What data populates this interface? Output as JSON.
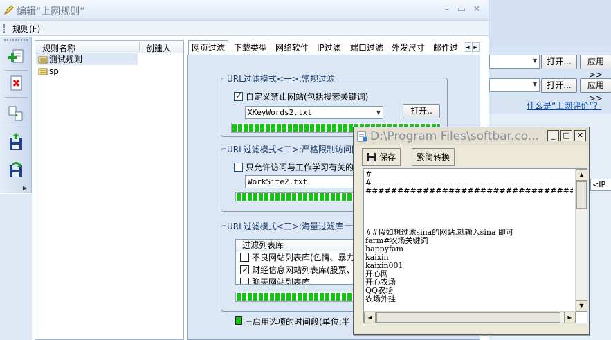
{
  "main_window": {
    "title": "编辑“上网规则”",
    "minimize": "–",
    "maximize": "▭",
    "close": "✕"
  },
  "menu": {
    "rules": "规则(F)"
  },
  "rule_list": {
    "columns": [
      "规则名称",
      "创建人"
    ],
    "rows": [
      {
        "name": "测试规则"
      },
      {
        "name": "sp"
      }
    ]
  },
  "tabs": [
    "网页过滤",
    "下载类型",
    "网络软件",
    "IP过滤",
    "端口过滤",
    "外发尺寸",
    "邮件过"
  ],
  "tab_arrows": {
    "left": "◄",
    "right": "►"
  },
  "mode1": {
    "title": "URL过滤模式<一>:常规过滤",
    "checkbox_label": "自定义禁止网站(包括搜索关键词)",
    "file": "XKeyWords2.txt",
    "open_button": "打开.."
  },
  "mode2": {
    "title": "URL过滤模式<二>:严格限制访问网站",
    "checkbox_label": "只允许访问与工作学习有关的",
    "file": "WorkSite2.txt"
  },
  "mode3": {
    "title": "URL过滤模式<三>:海量过滤库",
    "list_header": "过滤列表库",
    "items": [
      {
        "label": "不良网站列表库(色情、暴力)",
        "checked": false
      },
      {
        "label": "财经信息网站列表库(股票、",
        "checked": true
      },
      {
        "label": "聊天网站列表库、",
        "checked": false
      }
    ]
  },
  "legend": {
    "text": "=启用选项的时间段(单位:半"
  },
  "background_window": {
    "open_button": "打开...",
    "apply_button": "应用>>",
    "link": "什么是“上网评价”？",
    "ip_field": "<IP"
  },
  "editor": {
    "title": "D:\\Program Files\\softbar.co...",
    "save_button": "保存",
    "convert_button": "繁简转换",
    "lines": [
      "#",
      "#",
      "##############################################################",
      "",
      "",
      "",
      "",
      "##假如想过滤sina的网站,就输入sina 即可",
      "farm#农场关键词",
      "happyfam",
      "kaixin",
      "kaixin001",
      "开心网",
      "开心农场",
      "QQ农场",
      "农场外挂"
    ],
    "scroll_up": "▲",
    "scroll_down": "▼",
    "scroll_left": "◄",
    "scroll_right": "►"
  },
  "progress": {
    "mode1": 1.0,
    "mode2": 1.0,
    "mode3": 1.0
  },
  "colors": {
    "progress_green": "#17c317",
    "accent_blue": "#0645ad",
    "active_border": "#8fa6c4"
  }
}
